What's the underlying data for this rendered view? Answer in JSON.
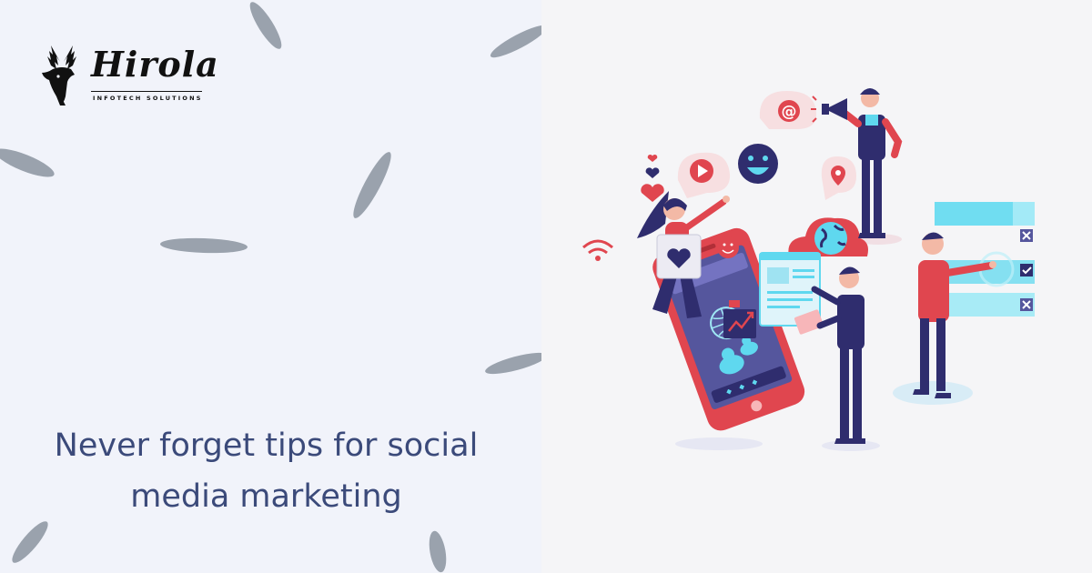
{
  "brand": {
    "name": "Hirola",
    "tagline": "INFOTECH SOLUTIONS",
    "logo_icon": "deer-head-icon"
  },
  "headline": {
    "line1": "Never forget tips for social",
    "line2": "media marketing"
  },
  "colors": {
    "left_background": "#f1f3fa",
    "right_background": "#f5f5f7",
    "headline": "#3b4a7a",
    "accent_red": "#e0464f",
    "accent_navy": "#2f2d6e",
    "accent_cyan": "#5fd8ef",
    "leaf_gray": "#9aa2ad"
  },
  "illustration": {
    "name": "social-media-marketing-illustration",
    "icons": [
      "phone-icon",
      "heart-icon",
      "play-icon",
      "smiley-icon",
      "at-sign-icon",
      "megaphone-icon",
      "location-pin-icon",
      "globe-icon",
      "wifi-icon",
      "chart-up-icon",
      "checklist-icon"
    ]
  }
}
